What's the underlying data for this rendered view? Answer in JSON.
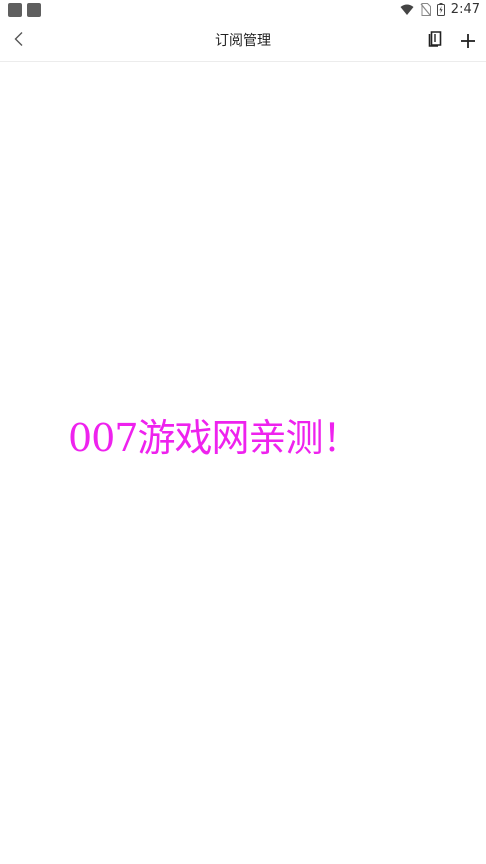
{
  "status_bar": {
    "time": "2:47",
    "icons": [
      "app-notification-icon",
      "app-notification-icon",
      "wifi-icon",
      "no-signal-icon",
      "battery-charging-icon"
    ]
  },
  "header": {
    "title": "订阅管理",
    "back_icon": "chevron-left-icon",
    "book_icon": "book-icon",
    "add_icon": "plus-icon"
  },
  "content": {
    "watermark": "007游戏网亲测！",
    "watermark_color": "#ee22ee"
  }
}
